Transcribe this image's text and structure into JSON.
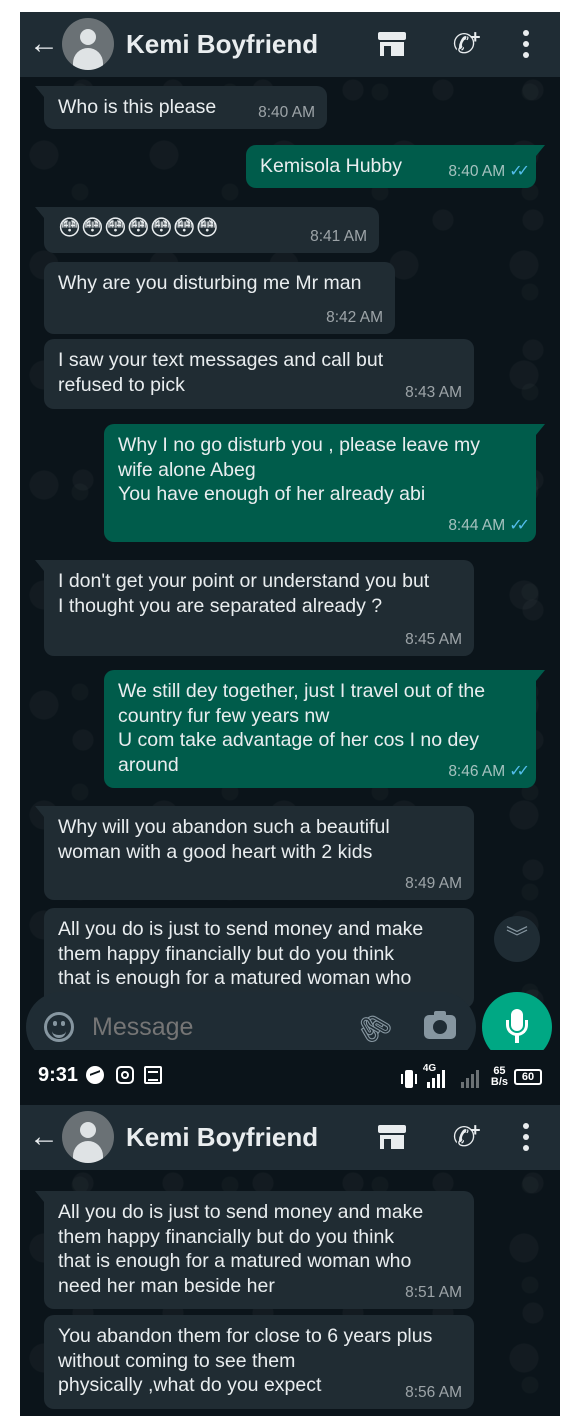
{
  "chat": {
    "contact_name": "Kemi Boyfriend",
    "avatar_icon": "default-profile-avatar",
    "icons": {
      "back": "arrow-left-icon",
      "store": "store-icon",
      "call": "add-call-icon",
      "menu": "more-vertical-icon"
    },
    "messages": [
      {
        "dir": "in",
        "text": "Who is this please",
        "time": "8:40 AM"
      },
      {
        "dir": "out",
        "text": "Kemisola Hubby",
        "time": "8:40 AM",
        "ticks": "✓✓"
      },
      {
        "dir": "in",
        "text": "😳😳😳😳😳😳😳",
        "time": "8:41 AM"
      },
      {
        "dir": "in",
        "text": "Why are you disturbing me Mr man",
        "time": "8:42 AM"
      },
      {
        "dir": "in",
        "text": "I saw your text messages and call but\nrefused to pick",
        "time": "8:43 AM"
      },
      {
        "dir": "out",
        "text": "Why I no go disturb you , please leave my\nwife alone Abeg\nYou have enough of her already abi",
        "time": "8:44 AM",
        "ticks": "✓✓"
      },
      {
        "dir": "in",
        "text": "I don't get your point or understand you but\nI thought you are separated already ?",
        "time": "8:45 AM"
      },
      {
        "dir": "out",
        "text": "We still dey together, just I travel out of the\ncountry fur few years nw\nU com take advantage of her cos I no dey\naround",
        "time": "8:46 AM",
        "ticks": "✓✓"
      },
      {
        "dir": "in",
        "text": "Why will you abandon such a beautiful\nwoman with a good heart with 2 kids",
        "time": "8:49 AM"
      },
      {
        "dir": "in",
        "text": "All you do is just to send money and make\nthem happy financially but do you think\nthat is enough for a matured woman who",
        "time": ""
      }
    ],
    "scroll_down_icon": "double-chevron-down-icon",
    "composer": {
      "placeholder": "Message",
      "emoji_icon": "emoji-icon",
      "attach_icon": "paperclip-icon",
      "camera_icon": "camera-icon",
      "mic_icon": "microphone-icon",
      "mic_color": "#00a884"
    }
  },
  "status_bar": {
    "time": "9:31",
    "network": "4G",
    "speed_value": "65",
    "speed_unit": "B/s",
    "battery": "60",
    "icons": [
      "messenger-icon",
      "instagram-icon",
      "news-icon",
      "vibrate-icon",
      "signal-icon",
      "battery-icon"
    ]
  },
  "chat2": {
    "contact_name": "Kemi Boyfriend",
    "messages": [
      {
        "dir": "in",
        "text": "All you do is just to send money and make\nthem happy financially but do you think\nthat is enough for a matured woman who\nneed her man beside her",
        "time": "8:51 AM"
      },
      {
        "dir": "in",
        "text": "You abandon them for close to 6 years plus\nwithout coming to see them\nphysically ,what do you expect",
        "time": "8:56 AM"
      }
    ]
  },
  "colors": {
    "background": "#0b141a",
    "header": "#1f2c34",
    "incoming_bubble": "#202c33",
    "outgoing_bubble": "#005c4b",
    "read_ticks": "#53bdeb"
  }
}
